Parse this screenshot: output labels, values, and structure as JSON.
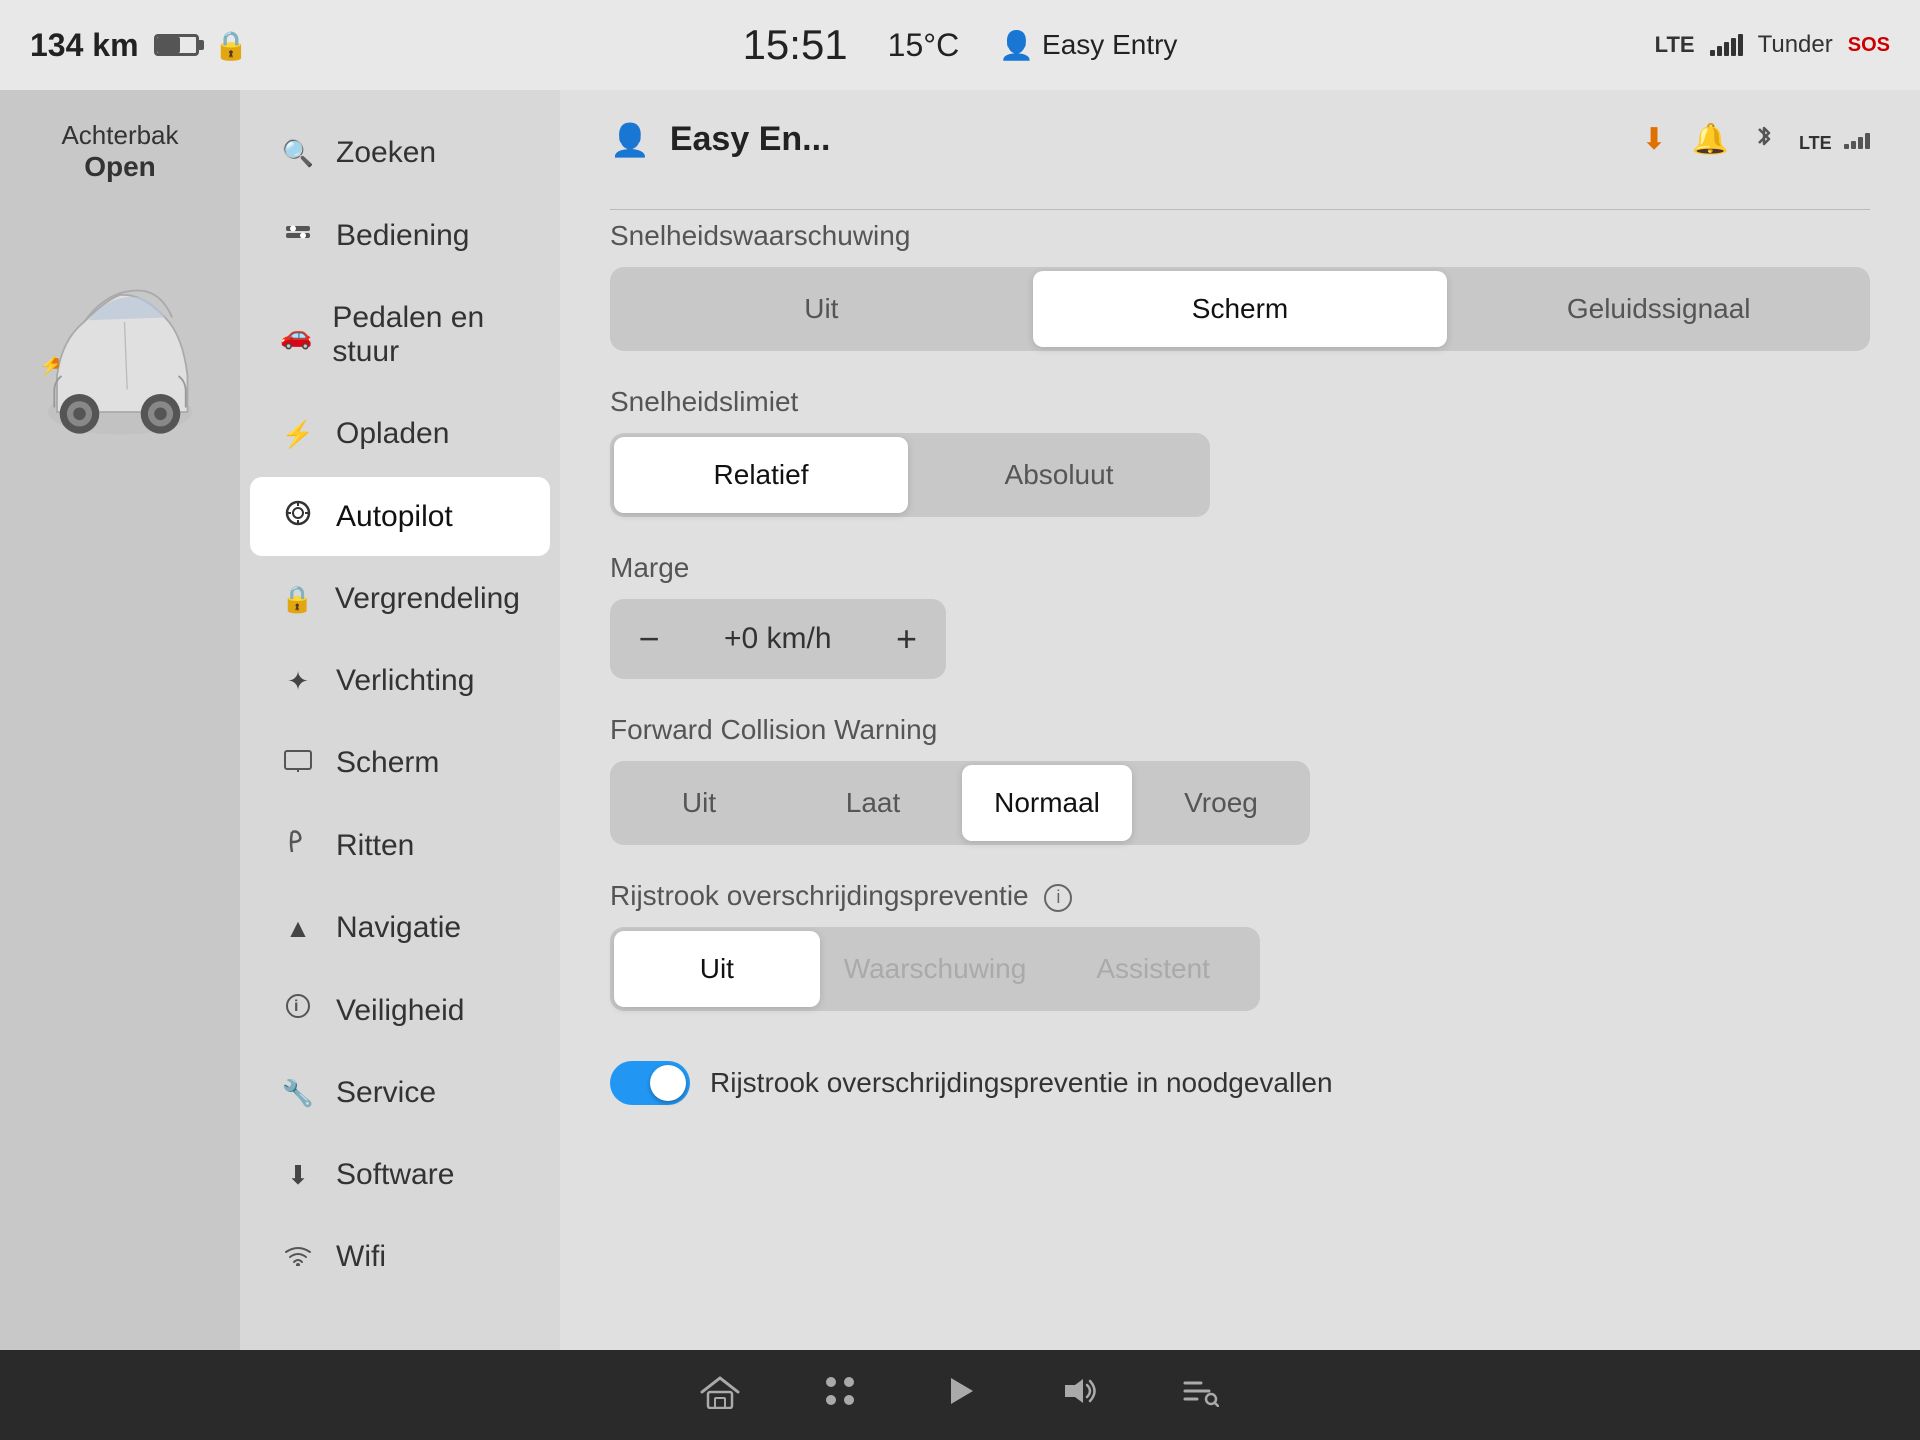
{
  "statusBar": {
    "range": "134 km",
    "time": "15:51",
    "temperature": "15°C",
    "profile": "Easy Entry",
    "network": "LTE",
    "carrier": "Tunder",
    "sos": "SOS"
  },
  "vehiclePanel": {
    "statusLine1": "Achterbak",
    "statusLine2": "Open"
  },
  "sidebar": {
    "items": [
      {
        "id": "zoeken",
        "label": "Zoeken",
        "icon": "🔍"
      },
      {
        "id": "bediening",
        "label": "Bediening",
        "icon": "⊞"
      },
      {
        "id": "pedalen",
        "label": "Pedalen en stuur",
        "icon": "🚗"
      },
      {
        "id": "opladen",
        "label": "Opladen",
        "icon": "⚡"
      },
      {
        "id": "autopilot",
        "label": "Autopilot",
        "icon": "⊙",
        "active": true
      },
      {
        "id": "vergrendeling",
        "label": "Vergrendeling",
        "icon": "🔒"
      },
      {
        "id": "verlichting",
        "label": "Verlichting",
        "icon": "✦"
      },
      {
        "id": "scherm",
        "label": "Scherm",
        "icon": "⊡"
      },
      {
        "id": "ritten",
        "label": "Ritten",
        "icon": "ʃ"
      },
      {
        "id": "navigatie",
        "label": "Navigatie",
        "icon": "▲"
      },
      {
        "id": "veiligheid",
        "label": "Veiligheid",
        "icon": "ℹ"
      },
      {
        "id": "service",
        "label": "Service",
        "icon": "🔧"
      },
      {
        "id": "software",
        "label": "Software",
        "icon": "⬇"
      },
      {
        "id": "wifi",
        "label": "Wifi",
        "icon": "📶"
      }
    ]
  },
  "settings": {
    "profileName": "Easy En...",
    "sections": {
      "snelheidswaarschuwing": {
        "label": "Snelheidswaarschuwing",
        "options": [
          "Uit",
          "Scherm",
          "Geluidssignaal"
        ],
        "active": "Scherm"
      },
      "snelheidslimiet": {
        "label": "Snelheidslimiet",
        "options": [
          "Relatief",
          "Absoluut"
        ],
        "active": "Relatief"
      },
      "marge": {
        "label": "Marge",
        "value": "+0 km/h",
        "minus": "−",
        "plus": "+"
      },
      "forwardCollision": {
        "label": "Forward Collision Warning",
        "options": [
          "Uit",
          "Laat",
          "Normaal",
          "Vroeg"
        ],
        "active": "Normaal"
      },
      "rijstrookPreventie": {
        "label": "Rijstrook overschrijdingspreventie",
        "options": [
          "Uit",
          "Waarschuwing",
          "Assistent"
        ],
        "active": "Uit"
      },
      "rijstrookToggle": {
        "label": "Rijstrook overschrijdingspreventie in noodgevallen",
        "enabled": true
      }
    }
  },
  "taskbar": {
    "icons": [
      "volume",
      "media"
    ]
  }
}
